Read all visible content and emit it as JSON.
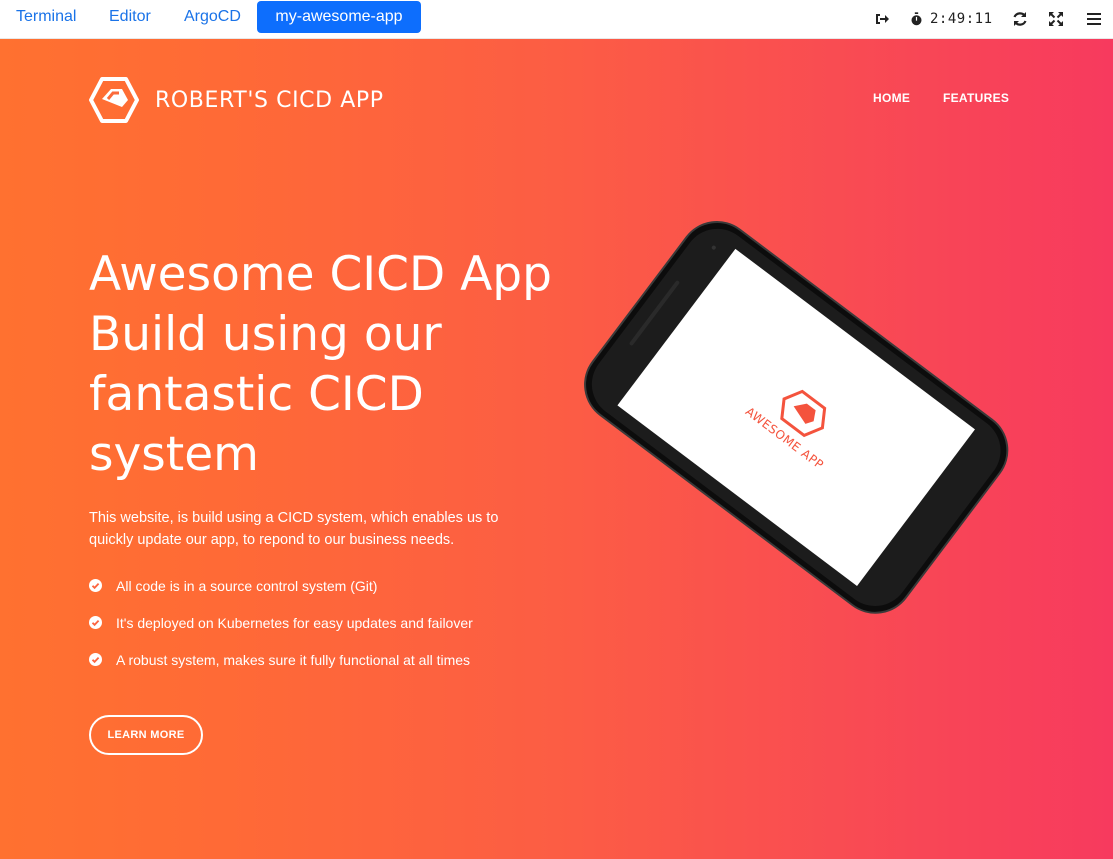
{
  "tabbar": {
    "tabs": [
      {
        "label": "Terminal",
        "active": false
      },
      {
        "label": "Editor",
        "active": false
      },
      {
        "label": "ArgoCD",
        "active": false
      },
      {
        "label": "my-awesome-app",
        "active": true
      }
    ],
    "timer": "2:49:11",
    "icons": [
      "logout-icon",
      "stopwatch-icon",
      "refresh-icon",
      "expand-icon",
      "menu-icon"
    ]
  },
  "site": {
    "brand": "ROBERT'S CICD APP",
    "nav": [
      "HOME",
      "FEATURES"
    ],
    "headline_lines": [
      "Awesome CICD App",
      "Build using our",
      "fantastic CICD",
      "system"
    ],
    "lead": "This website, is build using a CICD system, which enables us to quickly update our app, to repond to our business needs.",
    "features": [
      "All code is in a source control system (Git)",
      "It's deployed on Kubernetes for easy updates and failover",
      "A robust system, makes sure it fully functional at all times"
    ],
    "cta": "LEARN MORE",
    "phone_screen_text": "AWESOME APP"
  },
  "colors": {
    "tab_active": "#0d6efd",
    "tab_text": "#1a73e8",
    "gradient_start": "#ff7130",
    "gradient_end": "#f73a5e",
    "logo_on_phone": "#f4533d"
  }
}
